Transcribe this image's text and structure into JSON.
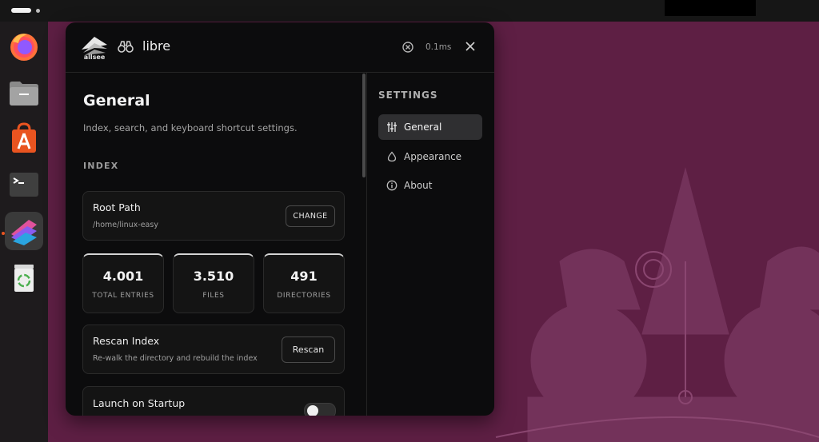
{
  "app": {
    "brand": "allsee",
    "title": "libre",
    "timing": "0.1ms"
  },
  "main": {
    "title": "General",
    "subtitle": "Index, search, and keyboard shortcut settings.",
    "section": "INDEX",
    "root_path": {
      "title": "Root Path",
      "path": "/home/linux-easy",
      "button": "CHANGE"
    },
    "stats": [
      {
        "value": "4.001",
        "label": "TOTAL ENTRIES"
      },
      {
        "value": "3.510",
        "label": "FILES"
      },
      {
        "value": "491",
        "label": "DIRECTORIES"
      }
    ],
    "rescan": {
      "title": "Rescan Index",
      "description": "Re-walk the directory and rebuild the index",
      "button": "Rescan"
    },
    "startup": {
      "title": "Launch on Startup",
      "enabled": false
    }
  },
  "sidebar": {
    "label": "SETTINGS",
    "items": [
      {
        "label": "General",
        "icon": "sliders-icon",
        "active": true
      },
      {
        "label": "Appearance",
        "icon": "droplet-icon",
        "active": false
      },
      {
        "label": "About",
        "icon": "info-icon",
        "active": false
      }
    ]
  },
  "dock": {
    "apps": [
      {
        "icon": "firefox-icon"
      },
      {
        "icon": "files-icon"
      },
      {
        "icon": "app-center-icon"
      },
      {
        "icon": "terminal-icon"
      },
      {
        "icon": "allsee-icon",
        "active": true
      },
      {
        "icon": "trash-icon"
      }
    ]
  },
  "colors": {
    "accent": "#e95420",
    "wallpaper": "#5e1f44",
    "panel": "#0c0c0d"
  }
}
